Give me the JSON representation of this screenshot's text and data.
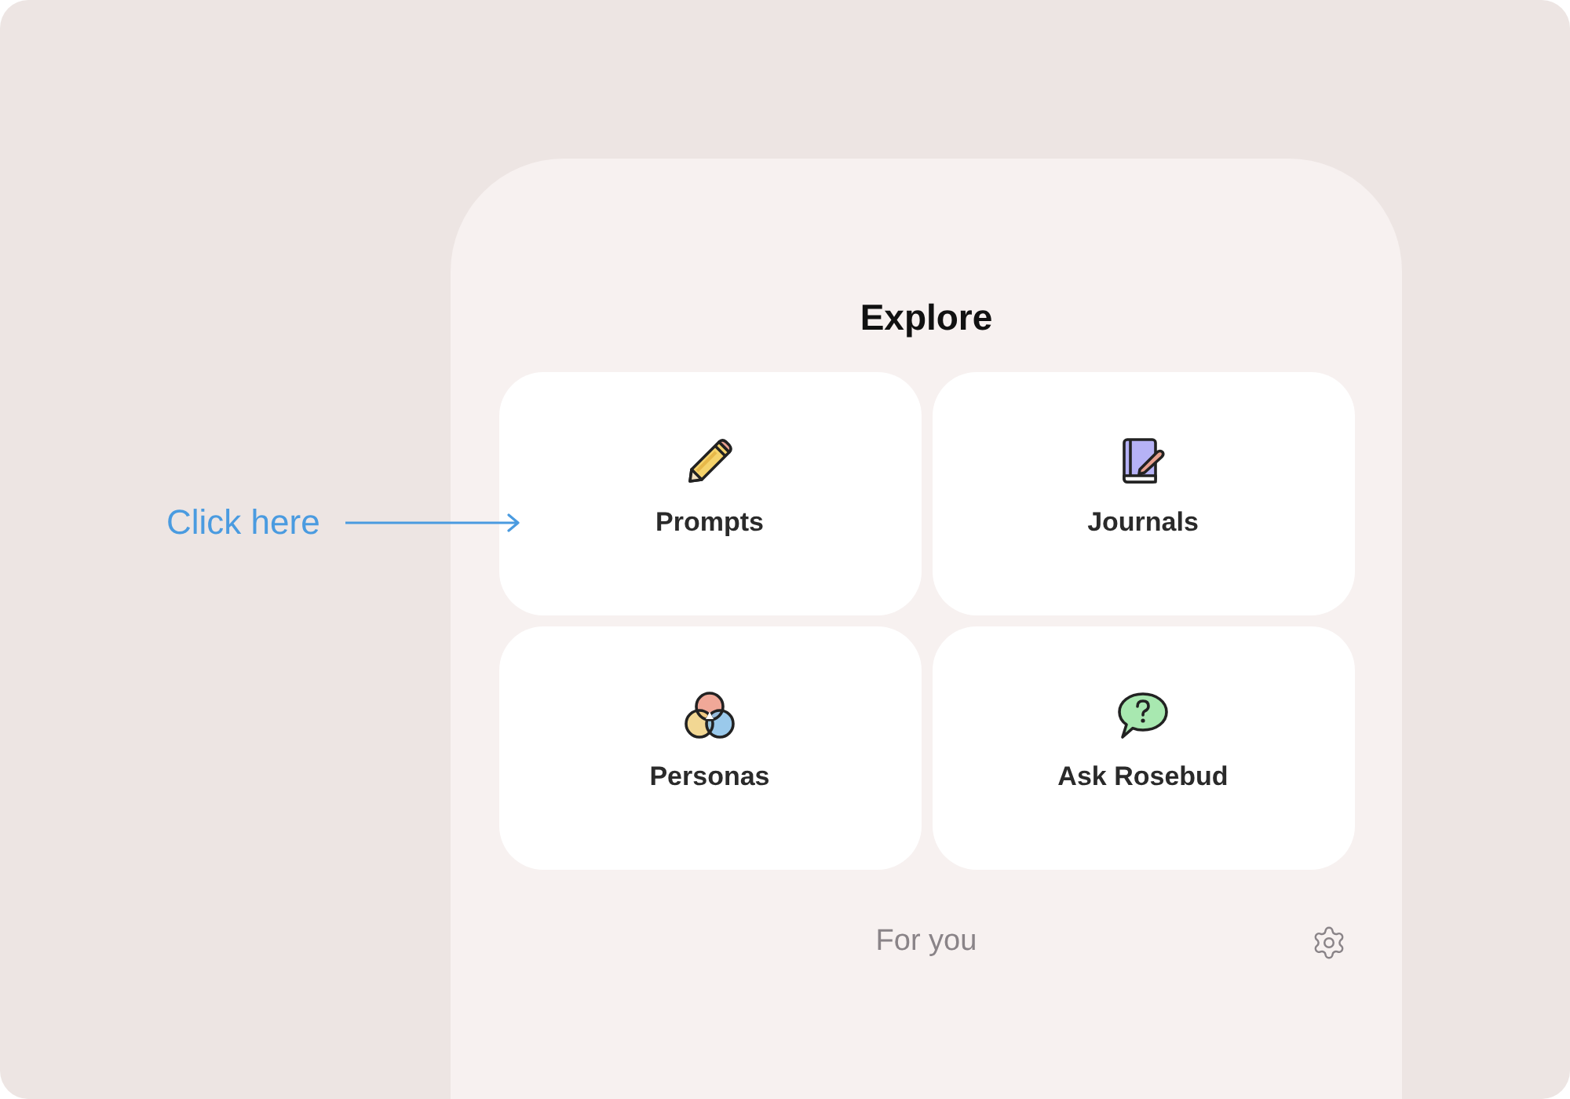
{
  "annotation": {
    "label": "Click here"
  },
  "screen": {
    "title": "Explore",
    "cards": [
      {
        "label": "Prompts",
        "kind": "pencil"
      },
      {
        "label": "Journals",
        "kind": "book"
      },
      {
        "label": "Personas",
        "kind": "venn"
      },
      {
        "label": "Ask Rosebud",
        "kind": "question"
      }
    ],
    "bottom_bar": {
      "label": "For you"
    }
  }
}
